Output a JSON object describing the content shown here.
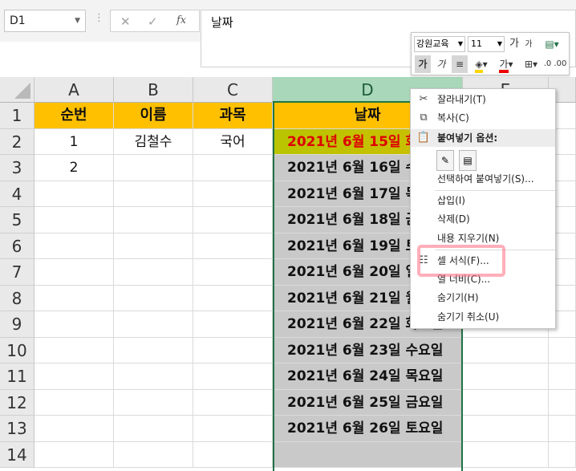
{
  "formula_bar": {
    "name_box": "D1",
    "cancel_glyph": "✕",
    "enter_glyph": "✓",
    "fx_glyph": "fx",
    "content": "날짜"
  },
  "columns": [
    "A",
    "B",
    "C",
    "D",
    "E"
  ],
  "rows": [
    "1",
    "2",
    "3",
    "4",
    "5",
    "6",
    "7",
    "8",
    "9",
    "10",
    "11",
    "12",
    "13",
    "14"
  ],
  "headers": {
    "a": "순번",
    "b": "이름",
    "c": "과목",
    "d": "날짜"
  },
  "row2": {
    "a": "1",
    "b": "김철수",
    "c": "국어"
  },
  "row3": {
    "a": "2"
  },
  "dates": [
    "2021년 6월 15일 화",
    "2021년 6월 16일 수",
    "2021년 6월 17일 목",
    "2021년 6월 18일 금",
    "2021년 6월 19일 토",
    "2021년 6월 20일 일",
    "2021년 6월 21일 월",
    "2021년 6월 22일 화요일",
    "2021년 6월 23일 수요일",
    "2021년 6월 24일 목요일",
    "2021년 6월 25일 금요일",
    "2021년 6월 26일 토요일"
  ],
  "mini_toolbar": {
    "font_name": "강원교육",
    "font_size": "11",
    "grow": "가",
    "shrink": "가",
    "bold": "가",
    "italic": "가",
    "font_color_letter": "가"
  },
  "context_menu": {
    "cut": "잘라내기(T)",
    "copy": "복사(C)",
    "paste_options": "붙여넣기 옵션:",
    "paste_special": "선택하여 붙여넣기(S)...",
    "insert": "삽입(I)",
    "delete": "삭제(D)",
    "clear": "내용 지우기(N)",
    "format_cells": "셀 서식(F)...",
    "col_width": "열 너비(C)...",
    "hide": "숨기기(H)",
    "unhide": "숨기기 취소(U)"
  },
  "colors": {
    "header_fill": "#ffc000",
    "selection_fill": "#c9c9c9",
    "accent_green": "#217346",
    "first_date_text": "#dd0000"
  }
}
